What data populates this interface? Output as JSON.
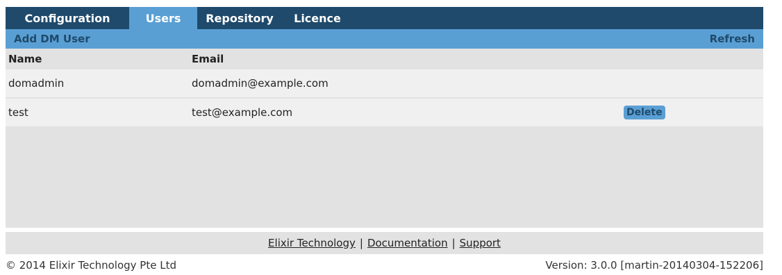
{
  "tabs": [
    {
      "label": "Configuration"
    },
    {
      "label": "Users"
    },
    {
      "label": "Repository"
    },
    {
      "label": "Licence"
    }
  ],
  "actions": {
    "add_user": "Add DM User",
    "refresh": "Refresh"
  },
  "table": {
    "columns": [
      "Name",
      "Email"
    ],
    "rows": [
      {
        "name": "domadmin",
        "email": "domadmin@example.com",
        "action": ""
      },
      {
        "name": "test",
        "email": "test@example.com",
        "action": "Delete"
      }
    ]
  },
  "footer": {
    "links": [
      "Elixir Technology",
      "Documentation",
      "Support"
    ],
    "separator": "|",
    "copyright": "© 2014 Elixir Technology Pte Ltd",
    "version": "Version: 3.0.0 [martin-20140304-152206]"
  },
  "colors": {
    "tabbar": "#1f4a6b",
    "accent": "#5a9fd4",
    "panel": "#e2e2e2",
    "row": "#f0f0f0"
  }
}
